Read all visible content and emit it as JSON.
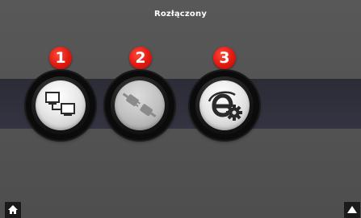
{
  "header": {
    "title": "Rozłączony"
  },
  "buttons": [
    {
      "badge": "1",
      "icon": "network-computers-icon",
      "enabled": true
    },
    {
      "badge": "2",
      "icon": "disconnected-plug-icon",
      "enabled": false
    },
    {
      "badge": "3",
      "icon": "internet-explorer-settings-icon",
      "enabled": true
    }
  ],
  "footer": {
    "home_icon": "home-icon",
    "up_icon": "up-arrow-icon"
  },
  "colors": {
    "background": "#555555",
    "band": "#30303c",
    "badge": "#e01810",
    "button_face": "#e8e8e8"
  }
}
